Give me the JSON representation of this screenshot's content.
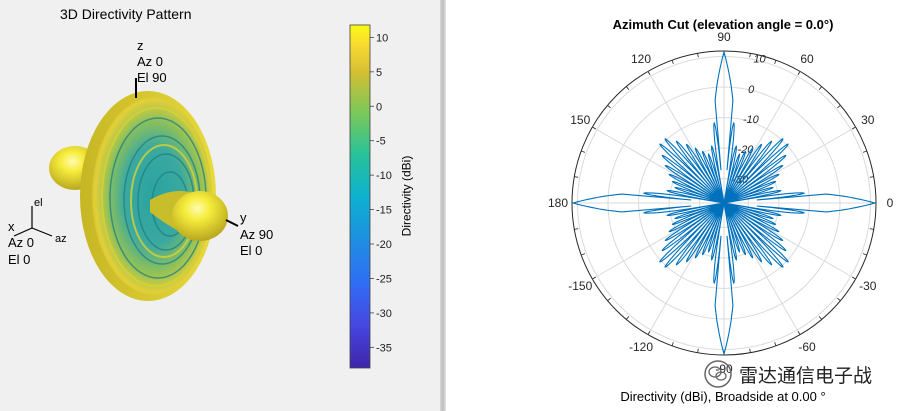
{
  "left": {
    "title": "3D Directivity Pattern",
    "axis_z": {
      "name": "z",
      "az": "Az 0",
      "el": "El 90"
    },
    "axis_y": {
      "name": "y",
      "az": "Az 90",
      "el": "El 0"
    },
    "axis_x": {
      "name": "x",
      "az": "Az 0",
      "el": "El 0"
    },
    "triad": {
      "el": "el",
      "az": "az"
    },
    "colorbar": {
      "label": "Directivity (dBi)",
      "ticks": [
        "10",
        "5",
        "0",
        "-5",
        "-10",
        "-15",
        "-20",
        "-25",
        "-30",
        "-35"
      ],
      "range": [
        -38,
        11.8
      ]
    }
  },
  "right": {
    "title": "Azimuth Cut (elevation angle = 0.0°)",
    "angle_labels": [
      "0",
      "30",
      "60",
      "90",
      "120",
      "150",
      "180",
      "-150",
      "-120",
      "-90",
      "-60",
      "-30"
    ],
    "radial_labels": [
      "10",
      "0",
      "-10",
      "-20",
      "-30"
    ],
    "footer": "Directivity (dBi), Broadside at 0.00 °",
    "series_color": "#0072bd"
  },
  "watermark": "雷达通信电子战",
  "chart_data": {
    "type": "line",
    "title": "Azimuth Cut (elevation angle = 0.0°)",
    "xlabel": "",
    "ylabel": "Directivity (dBi), Broadside at 0.00 °",
    "polar": true,
    "theta_deg": [
      0,
      3,
      8,
      15,
      25,
      35,
      45,
      55,
      65,
      75,
      82,
      87,
      90,
      93,
      98,
      105,
      115,
      125,
      135,
      145,
      155,
      165,
      172,
      177,
      180,
      183,
      188,
      195,
      205,
      215,
      225,
      235,
      245,
      255,
      262,
      267,
      270,
      273,
      278,
      285,
      295,
      305,
      315,
      325,
      335,
      345,
      352,
      357
    ],
    "r_dBi": [
      11.5,
      2,
      -14,
      -22,
      -19,
      -14,
      -8,
      -14,
      -19,
      -22,
      -14,
      2,
      11.5,
      2,
      -14,
      -22,
      -19,
      -14,
      -8,
      -14,
      -19,
      -22,
      -14,
      2,
      11.5,
      2,
      -14,
      -22,
      -19,
      -14,
      -8,
      -14,
      -19,
      -22,
      -14,
      2,
      11.5,
      2,
      -14,
      -22,
      -19,
      -14,
      -8,
      -14,
      -19,
      -22,
      -14,
      2
    ],
    "rlim": [
      -38,
      11.8
    ],
    "grid": true
  }
}
